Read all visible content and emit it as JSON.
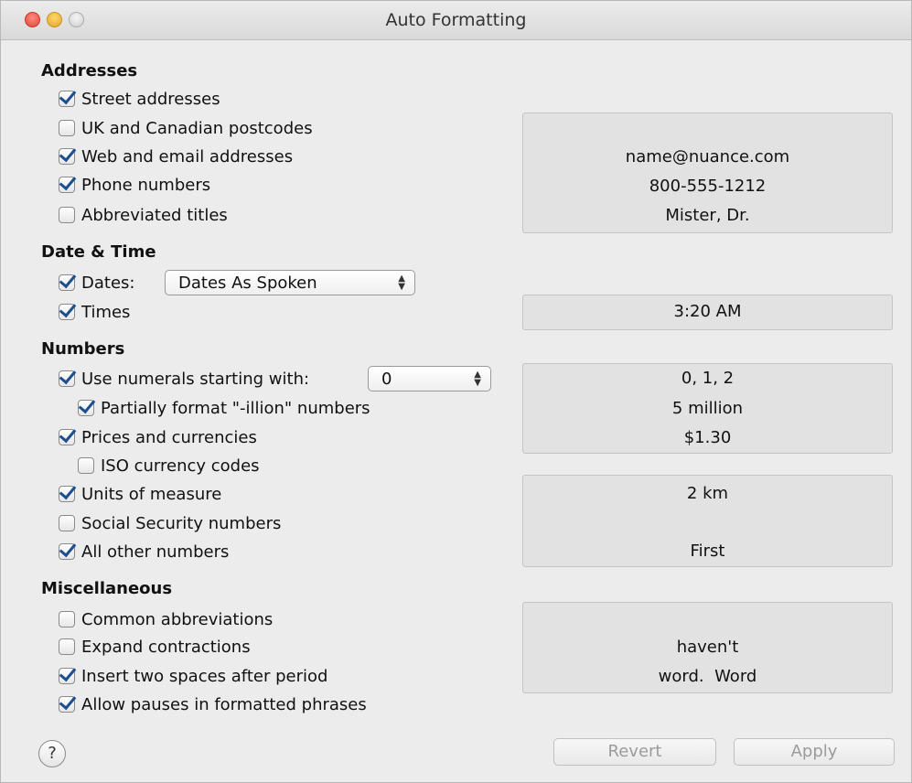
{
  "window": {
    "title": "Auto Formatting"
  },
  "sections": {
    "addresses": "Addresses",
    "datetime": "Date & Time",
    "numbers": "Numbers",
    "misc": "Miscellaneous"
  },
  "options": {
    "street": {
      "label": "Street addresses",
      "checked": true
    },
    "postcodes": {
      "label": "UK and Canadian postcodes",
      "checked": false
    },
    "web": {
      "label": "Web and email addresses",
      "checked": true
    },
    "phone": {
      "label": "Phone numbers",
      "checked": true
    },
    "titles": {
      "label": "Abbreviated titles",
      "checked": false
    },
    "dates": {
      "label": "Dates:",
      "checked": true
    },
    "times": {
      "label": "Times",
      "checked": true
    },
    "numerals": {
      "label": "Use numerals starting with:",
      "checked": true
    },
    "illion": {
      "label": "Partially format \"-illion\" numbers",
      "checked": true
    },
    "prices": {
      "label": "Prices and currencies",
      "checked": true
    },
    "iso": {
      "label": "ISO currency codes",
      "checked": false
    },
    "units": {
      "label": "Units of measure",
      "checked": true
    },
    "ssn": {
      "label": "Social Security numbers",
      "checked": false
    },
    "othernums": {
      "label": "All other numbers",
      "checked": true
    },
    "abbrev": {
      "label": "Common abbreviations",
      "checked": false
    },
    "contractions": {
      "label": "Expand contractions",
      "checked": false
    },
    "twospaces": {
      "label": "Insert two spaces after period",
      "checked": true
    },
    "pauses": {
      "label": "Allow pauses in formatted phrases",
      "checked": true
    }
  },
  "selects": {
    "dates": "Dates As Spoken",
    "numerals": "0"
  },
  "previews": {
    "addresses": [
      "name@nuance.com",
      "800-555-1212",
      "Mister, Dr."
    ],
    "times": "3:20 AM",
    "numbers": [
      "0, 1, 2",
      "5 million",
      "$1.30"
    ],
    "units": "2 km",
    "other": "First",
    "misc": [
      "haven't",
      "word.  Word"
    ]
  },
  "footer": {
    "help": "?",
    "revert": "Revert",
    "apply": "Apply"
  }
}
